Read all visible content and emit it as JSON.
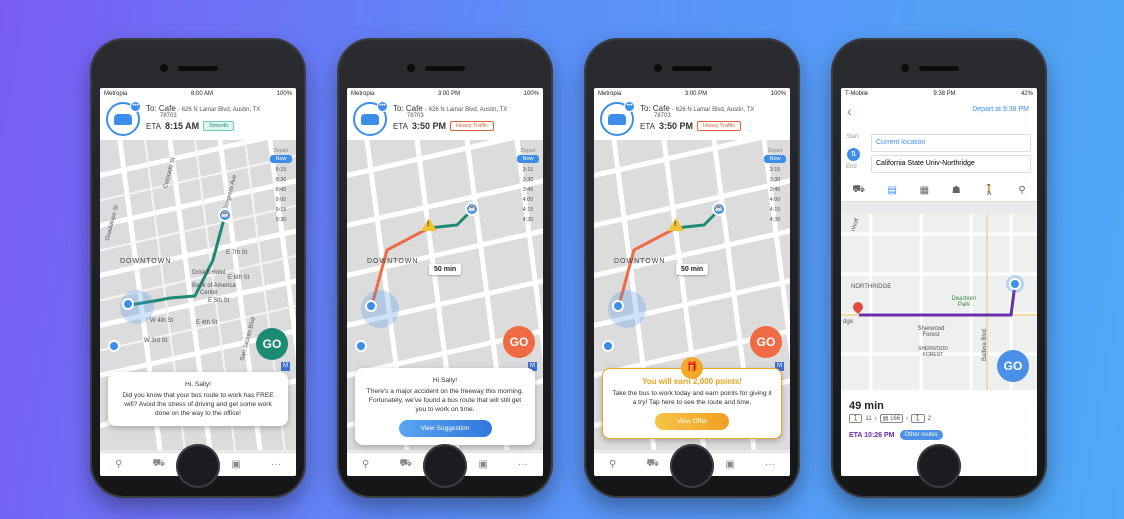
{
  "colors": {
    "accent": "#3d8eea",
    "teal_route": "#1d8a74",
    "orange_route": "#f06a43",
    "purple_route": "#6a2ea6",
    "gold": "#f3a827"
  },
  "phones": [
    {
      "status": {
        "carrier": "Metropia",
        "time": "8:00 AM",
        "battery": "100%"
      },
      "to_prefix": "To:",
      "to_name": "Cafe",
      "to_addr": "- 626 N Lamar Blvd, Austin, TX",
      "to_zip": "78703",
      "eta_label": "ETA",
      "eta_time": "8:15 AM",
      "traffic": "Smooth",
      "depart_label": "Depart",
      "now_label": "Now",
      "slots": [
        "8:15",
        "8:30",
        "8:45",
        "9:00",
        "9:15",
        "9:30"
      ],
      "map_labels": {
        "downtown": "DOWNTOWN",
        "hotel": "Driskill Hotel",
        "bank": "Bank of America",
        "center": "Center",
        "e7th": "E 7th St",
        "e6th": "E 6th St",
        "e5th": "E 5th St",
        "e4th": "E 4th St",
        "w4th": "W 4th St",
        "w3rd": "W 3rd St",
        "congress": "Congress Ave",
        "guadalupe": "Guadalupe St",
        "colorado": "Colorado St",
        "sanjacinto": "San Jacinto Blvd"
      },
      "go": "GO",
      "card": {
        "greeting": "Hi, Sally!",
        "body": "Did you know that your bus route to work has FREE wifi? Avoid the stress of driving and get some work done on the way to the office!"
      },
      "tabs": [
        "search-icon",
        "car-icon",
        "pin-icon",
        "wallet-icon",
        "more-icon"
      ]
    },
    {
      "status": {
        "carrier": "Metropia",
        "time": "3:00 PM",
        "battery": "100%"
      },
      "to_prefix": "To:",
      "to_name": "Cafe",
      "to_addr": "- 626 N Lamar Blvd, Austin, TX",
      "to_zip": "78703",
      "eta_label": "ETA",
      "eta_time": "3:50 PM",
      "traffic": "Heavy Traffic",
      "depart_label": "Depart",
      "now_label": "Now",
      "slots": [
        "3:15",
        "3:30",
        "3:45",
        "4:00",
        "4:15",
        "4:30"
      ],
      "duration": "50 min",
      "go": "GO",
      "card": {
        "greeting": "Hi Sally!",
        "body": "There's a major accident on the freeway this morning. Fortunately, we've found a bus route that will still get you to work on time.",
        "cta": "View Suggestion"
      }
    },
    {
      "status": {
        "carrier": "Metropia",
        "time": "3:00 PM",
        "battery": "100%"
      },
      "to_prefix": "To:",
      "to_name": "Cafe",
      "to_addr": "- 626 N Lamar Blvd, Austin, TX",
      "to_zip": "78703",
      "eta_label": "ETA",
      "eta_time": "3:50 PM",
      "traffic": "Heavy Traffic",
      "depart_label": "Depart",
      "now_label": "Now",
      "slots": [
        "3:15",
        "3:30",
        "3:45",
        "4:00",
        "4:15",
        "4:30"
      ],
      "duration": "50 min",
      "go": "GO",
      "card": {
        "reward": "You will earn 2,000 points!",
        "body": "Take the bus to work today and earn points for giving it a try! Tap here to see the route and time.",
        "cta": "View Offer"
      }
    },
    {
      "status": {
        "carrier": "T-Mobile",
        "time": "9:38 PM",
        "battery": "42%"
      },
      "depart": "Depart at 9:38 PM",
      "start_label": "Start",
      "end_label": "End",
      "start_placeholder": "Current location",
      "end_value": "California State Univ-Northridge",
      "map_labels": {
        "northridge": "NORTHRIDGE",
        "sherwood": "Sherwood Forest",
        "sherwood_caps": "SHERWOOD FOREST",
        "dearborn": "Dearborn Park",
        "balboa": "Balboa Blvd",
        "dge": "dge",
        "nhoff": "nhoff"
      },
      "go": "GO",
      "duration": "49 min",
      "walk1": "11",
      "bus": "166",
      "walk2": "2",
      "eta": "ETA 10:26 PM",
      "other_routes": "Other routes"
    }
  ]
}
